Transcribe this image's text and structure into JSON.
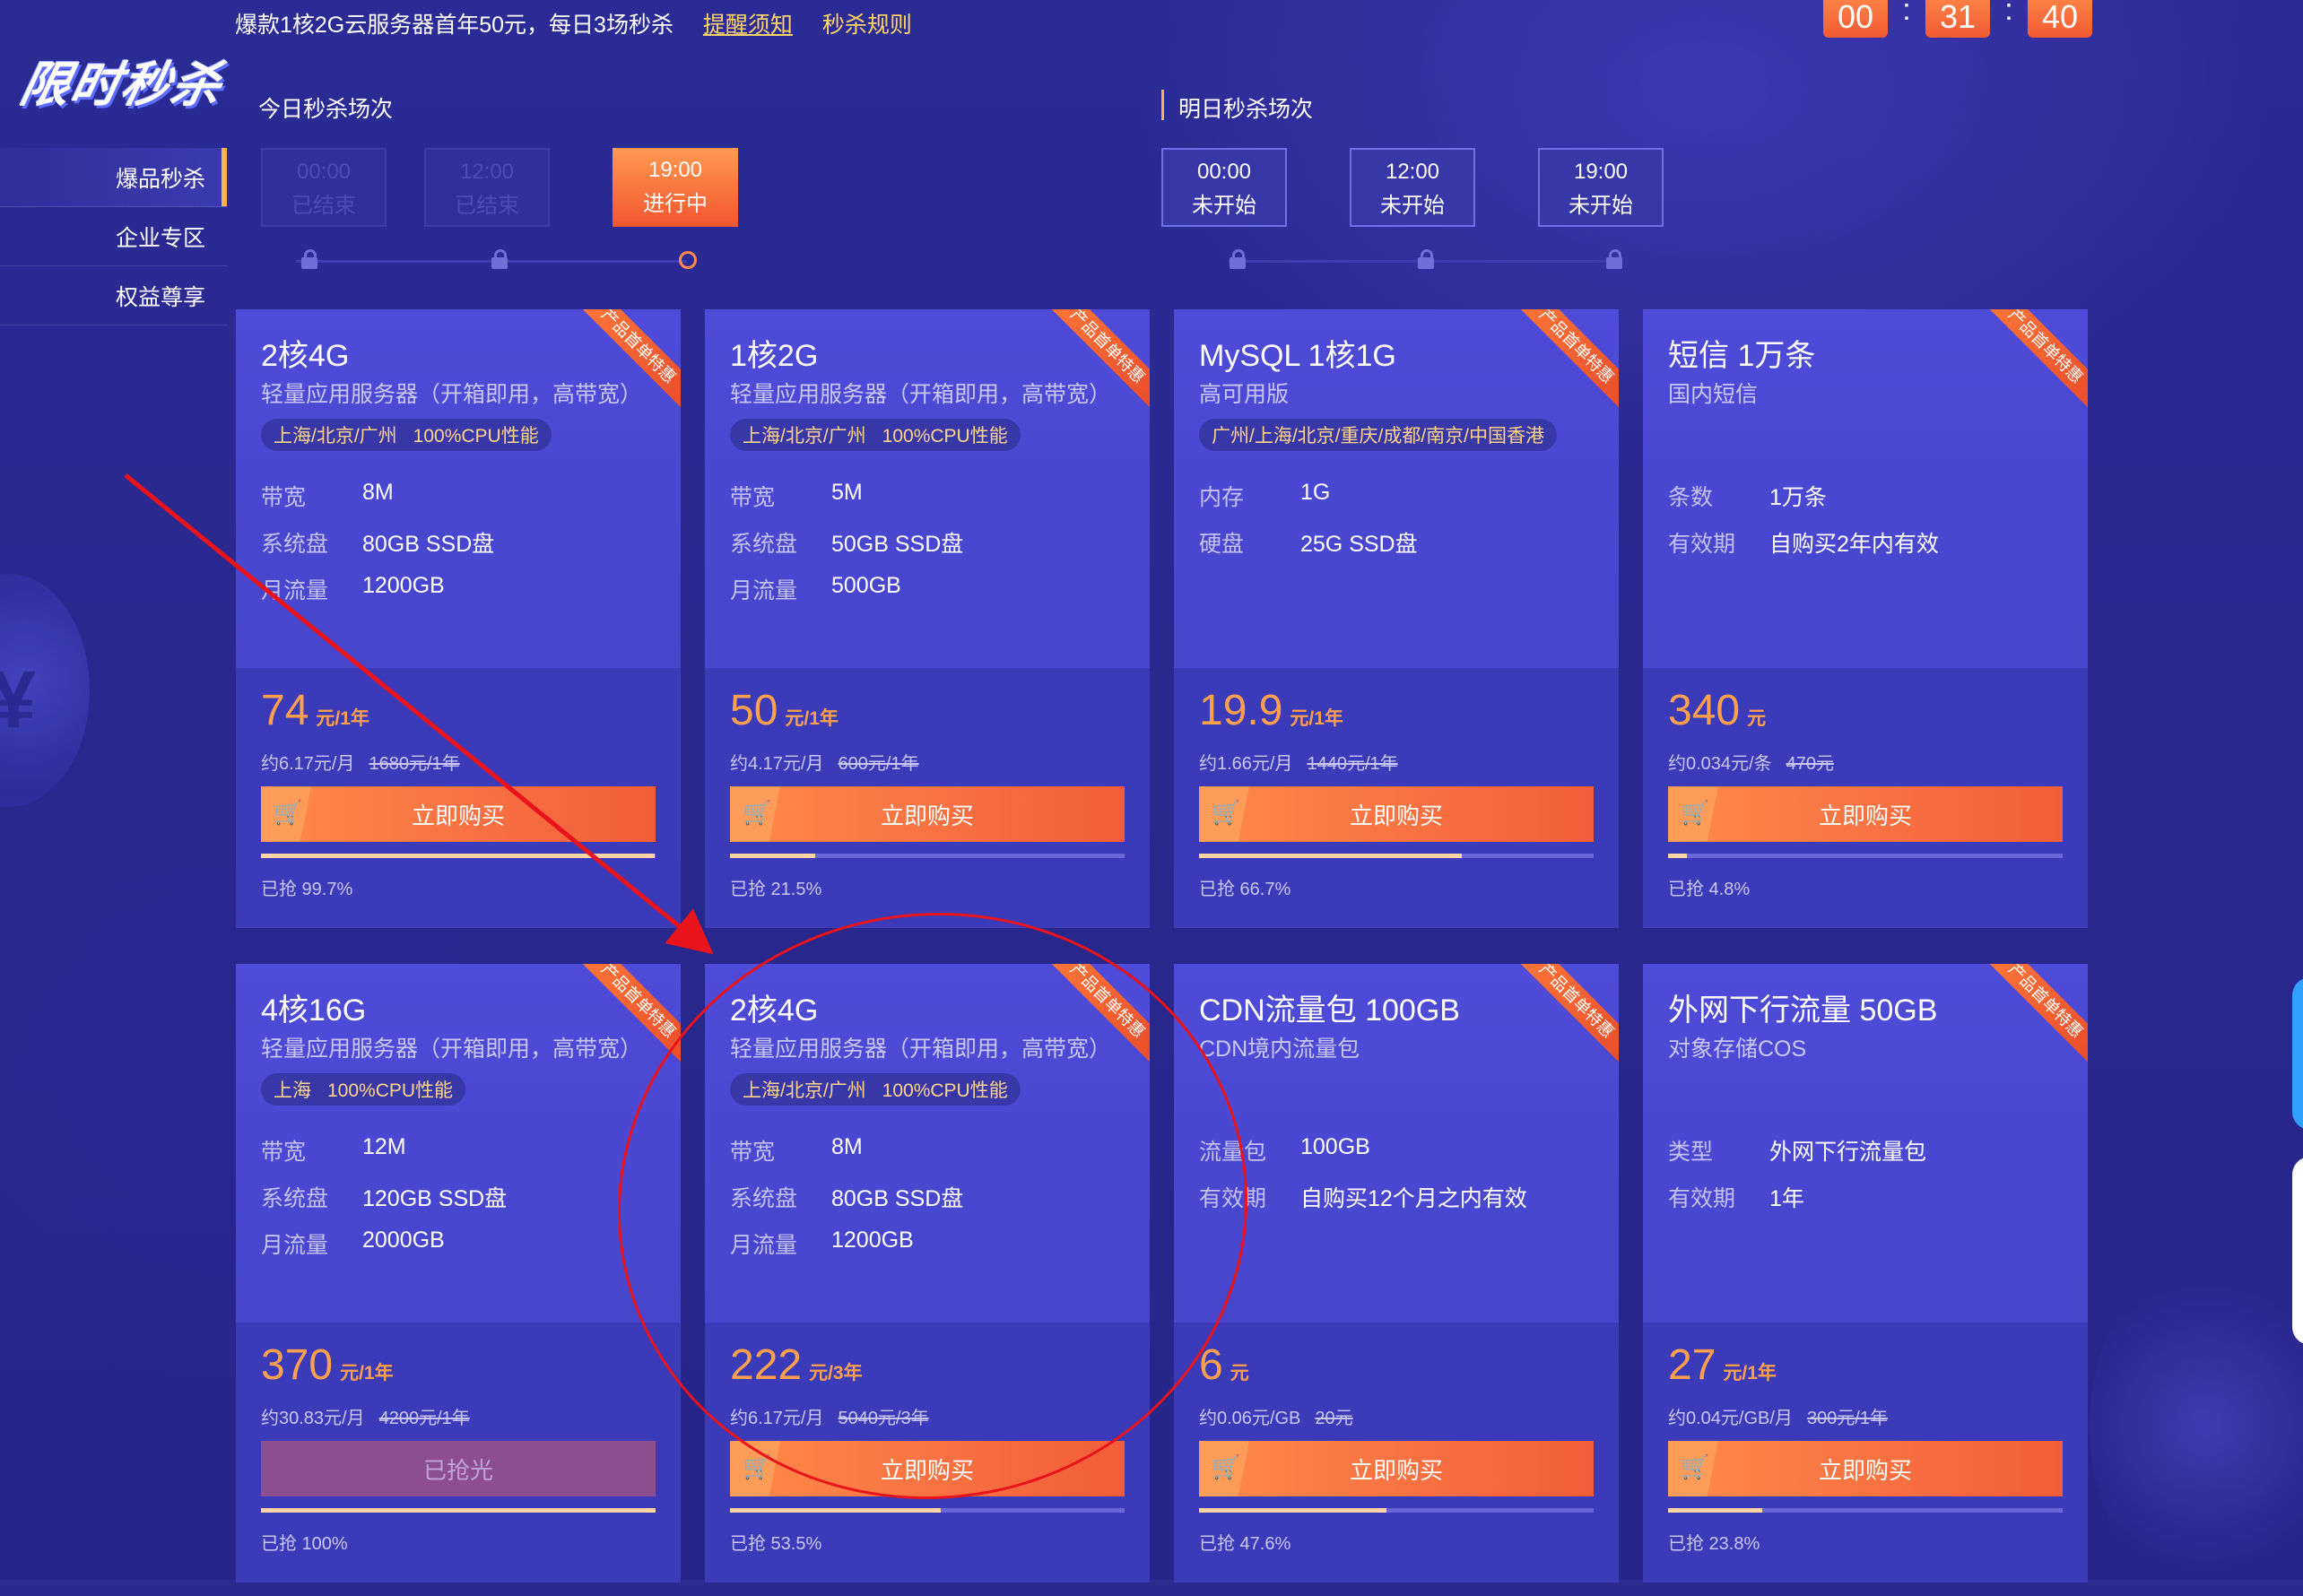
{
  "header": {
    "logo": "限时秒杀",
    "notice": "爆款1核2G云服务器首年50元，每日3场秒杀",
    "reminder_link": "提醒须知",
    "rules_link": "秒杀规则",
    "countdown": {
      "hours": "00",
      "minutes": "31",
      "seconds": "40"
    }
  },
  "sidebar": {
    "items": [
      {
        "label": "爆品秒杀",
        "active": true
      },
      {
        "label": "企业专区",
        "active": false
      },
      {
        "label": "权益尊享",
        "active": false
      }
    ]
  },
  "sessions": {
    "today_title": "今日秒杀场次",
    "tomorrow_title": "明日秒杀场次",
    "today": [
      {
        "time": "00:00",
        "status": "已结束"
      },
      {
        "time": "12:00",
        "status": "已结束"
      },
      {
        "time": "19:00",
        "status": "进行中"
      }
    ],
    "tomorrow": [
      {
        "time": "00:00",
        "status": "未开始"
      },
      {
        "time": "12:00",
        "status": "未开始"
      },
      {
        "time": "19:00",
        "status": "未开始"
      }
    ]
  },
  "ribbon_text": "产品首单特惠",
  "buy_label": "立即购买",
  "sold_out_label": "已抢光",
  "cards": [
    {
      "title": "2核4G",
      "subtitle": "轻量应用服务器（开箱即用，高带宽）",
      "region": "上海/北京/广州",
      "perf": "100%CPU性能",
      "specs": [
        {
          "k": "带宽",
          "v": "8M"
        },
        {
          "k": "系统盘",
          "v": "80GB SSD盘"
        },
        {
          "k": "月流量",
          "v": "1200GB"
        }
      ],
      "price": "74",
      "unit": "元/1年",
      "per": "约6.17元/月",
      "orig": "1680元/1年",
      "progress": 99.7,
      "grab": "已抢 99.7%"
    },
    {
      "title": "1核2G",
      "subtitle": "轻量应用服务器（开箱即用，高带宽）",
      "region": "上海/北京/广州",
      "perf": "100%CPU性能",
      "specs": [
        {
          "k": "带宽",
          "v": "5M"
        },
        {
          "k": "系统盘",
          "v": "50GB SSD盘"
        },
        {
          "k": "月流量",
          "v": "500GB"
        }
      ],
      "price": "50",
      "unit": "元/1年",
      "per": "约4.17元/月",
      "orig": "600元/1年",
      "progress": 21.5,
      "grab": "已抢 21.5%"
    },
    {
      "title": "MySQL 1核1G",
      "subtitle": "高可用版",
      "region": "广州/上海/北京/重庆/成都/南京/中国香港",
      "perf": "",
      "specs": [
        {
          "k": "内存",
          "v": "1G"
        },
        {
          "k": "硬盘",
          "v": "25G SSD盘"
        }
      ],
      "price": "19.9",
      "unit": "元/1年",
      "per": "约1.66元/月",
      "orig": "1440元/1年",
      "progress": 66.7,
      "grab": "已抢 66.7%"
    },
    {
      "title": "短信 1万条",
      "subtitle": "国内短信",
      "region": "",
      "perf": "",
      "specs": [
        {
          "k": "条数",
          "v": "1万条"
        },
        {
          "k": "有效期",
          "v": "自购买2年内有效"
        }
      ],
      "price": "340",
      "unit": "元",
      "per": "约0.034元/条",
      "orig": "470元",
      "progress": 4.8,
      "grab": "已抢 4.8%"
    },
    {
      "title": "4核16G",
      "subtitle": "轻量应用服务器（开箱即用，高带宽）",
      "region": "上海",
      "perf": "100%CPU性能",
      "specs": [
        {
          "k": "带宽",
          "v": "12M"
        },
        {
          "k": "系统盘",
          "v": "120GB SSD盘"
        },
        {
          "k": "月流量",
          "v": "2000GB"
        }
      ],
      "price": "370",
      "unit": "元/1年",
      "per": "约30.83元/月",
      "orig": "4200元/1年",
      "progress": 100,
      "grab": "已抢 100%",
      "sold_out": true
    },
    {
      "title": "2核4G",
      "subtitle": "轻量应用服务器（开箱即用，高带宽）",
      "region": "上海/北京/广州",
      "perf": "100%CPU性能",
      "specs": [
        {
          "k": "带宽",
          "v": "8M"
        },
        {
          "k": "系统盘",
          "v": "80GB SSD盘"
        },
        {
          "k": "月流量",
          "v": "1200GB"
        }
      ],
      "price": "222",
      "unit": "元/3年",
      "per": "约6.17元/月",
      "orig": "5040元/3年",
      "progress": 53.5,
      "grab": "已抢 53.5%"
    },
    {
      "title": "CDN流量包 100GB",
      "subtitle": "CDN境内流量包",
      "region": "",
      "perf": "",
      "specs": [
        {
          "k": "流量包",
          "v": "100GB"
        },
        {
          "k": "有效期",
          "v": "自购买12个月之内有效"
        }
      ],
      "price": "6",
      "unit": "元",
      "per": "约0.06元/GB",
      "orig": "20元",
      "progress": 47.6,
      "grab": "已抢 47.6%"
    },
    {
      "title": "外网下行流量 50GB",
      "subtitle": "对象存储COS",
      "region": "",
      "perf": "",
      "specs": [
        {
          "k": "类型",
          "v": "外网下行流量包"
        },
        {
          "k": "有效期",
          "v": "1年"
        }
      ],
      "price": "27",
      "unit": "元/1年",
      "per": "约0.04元/GB/月",
      "orig": "300元/1年",
      "progress": 23.8,
      "grab": "已抢 23.8%"
    }
  ],
  "colors": {
    "background": "#2a2a8f",
    "accent": "#ff8a4a",
    "price": "#ffa04f",
    "annotation": "#e8131b"
  }
}
